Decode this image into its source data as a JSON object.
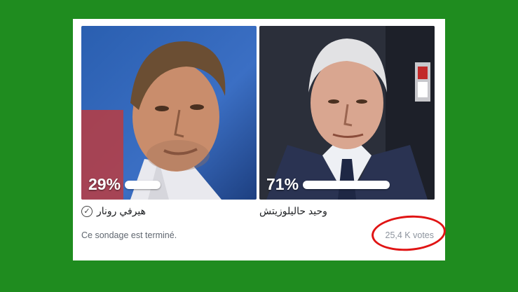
{
  "poll": {
    "options": [
      {
        "name": "هيرفي رونار",
        "percent_label": "29%",
        "percent": 29,
        "selected": true
      },
      {
        "name": "وحيد حاليلوزيتش",
        "percent_label": "71%",
        "percent": 71,
        "selected": false
      }
    ],
    "status": "Ce sondage est terminé.",
    "votes": "25,4 K votes"
  },
  "colors": {
    "background": "#1f8c1f",
    "card": "#ffffff",
    "highlight_ring": "#e01414"
  }
}
